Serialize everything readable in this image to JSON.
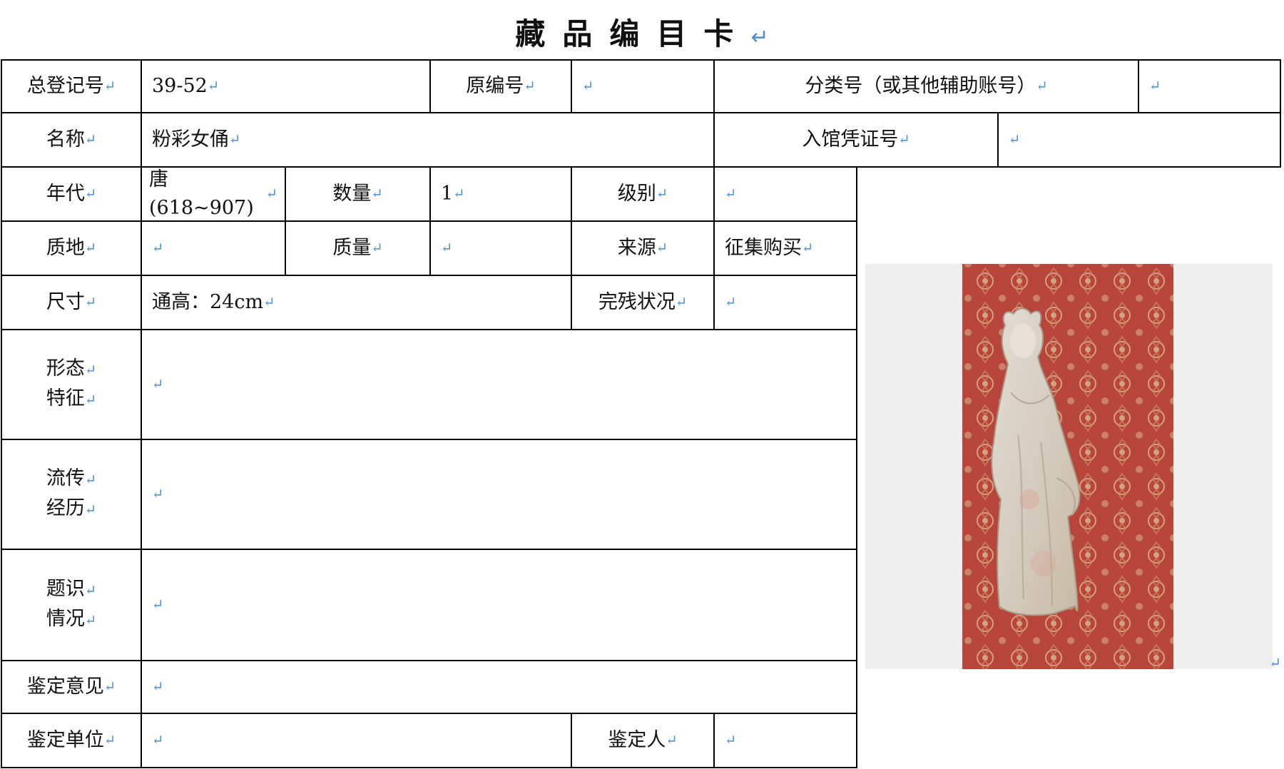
{
  "title": "藏品编目卡",
  "paragraph_mark": "↵",
  "rows": {
    "registration_no": {
      "label": "总登记号",
      "value": "39-52"
    },
    "original_no": {
      "label": "原编号",
      "value": ""
    },
    "classification_no": {
      "label": "分类号（或其他辅助账号）",
      "value": ""
    },
    "name": {
      "label": "名称",
      "value": "粉彩女俑"
    },
    "accession_voucher_no": {
      "label": "入馆凭证号",
      "value": ""
    },
    "period": {
      "label": "年代",
      "value": "唐(618~907)"
    },
    "quantity": {
      "label": "数量",
      "value": "1"
    },
    "grade": {
      "label": "级别",
      "value": ""
    },
    "material": {
      "label": "质地",
      "value": ""
    },
    "mass": {
      "label": "质量",
      "value": ""
    },
    "source": {
      "label": "来源",
      "value": "征集购买"
    },
    "dimensions": {
      "label": "尺寸",
      "value": "通高：24cm"
    },
    "condition": {
      "label": "完残状况",
      "value": ""
    },
    "form_features": {
      "label_line1": "形态",
      "label_line2": "特征",
      "value": ""
    },
    "provenance": {
      "label_line1": "流传",
      "label_line2": "经历",
      "value": ""
    },
    "inscriptions": {
      "label_line1": "题识",
      "label_line2": "情况",
      "value": ""
    },
    "appraisal_opinion": {
      "label": "鉴定意见",
      "value": ""
    },
    "appraisal_unit": {
      "label": "鉴定单位",
      "value": ""
    },
    "appraiser": {
      "label": "鉴定人",
      "value": ""
    }
  },
  "photo": {
    "subject": "painted pottery female figurine on red patterned silk",
    "colors": {
      "background": "#efefef",
      "fabric": "#b8453c",
      "pattern": "#d9a27a",
      "figure": "#d8d1c7"
    }
  }
}
